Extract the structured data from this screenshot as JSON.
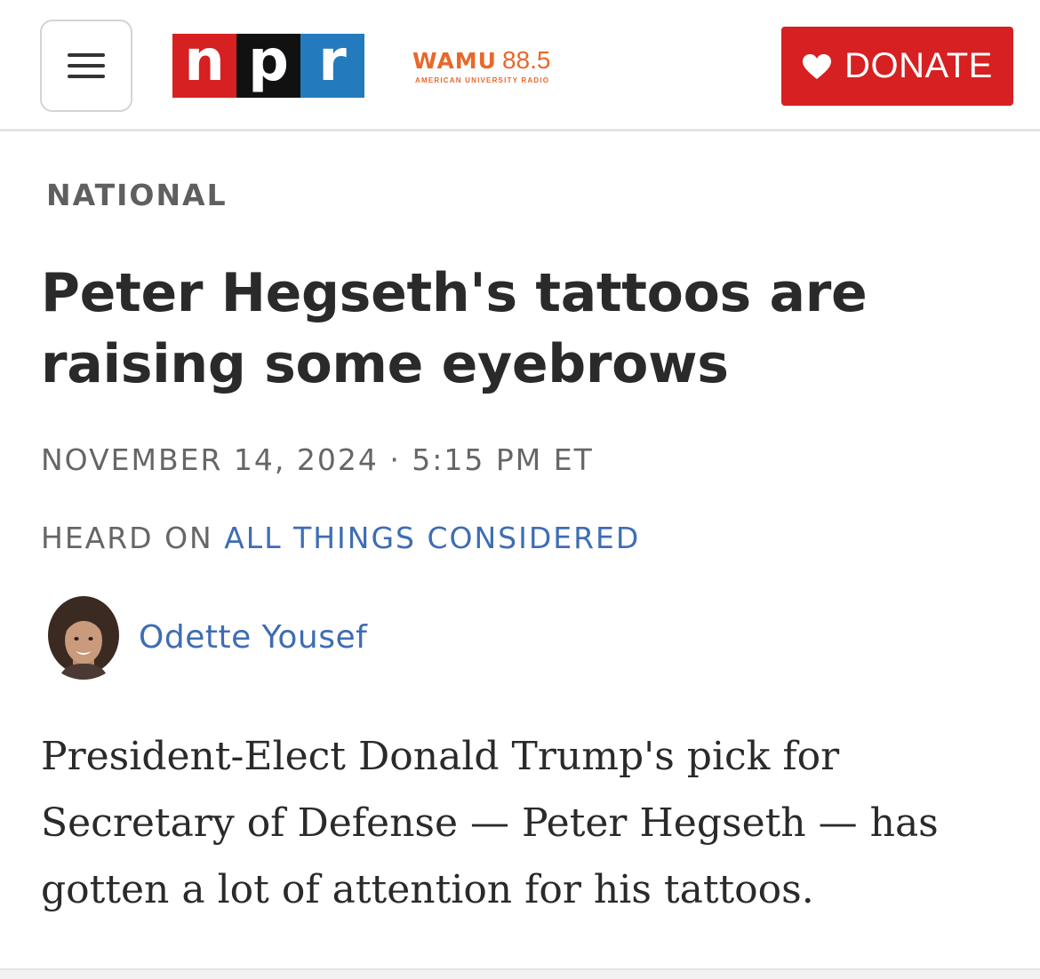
{
  "header": {
    "menu_icon": "hamburger-menu-icon",
    "logo": {
      "letters": [
        "n",
        "p",
        "r"
      ],
      "colors": [
        "#d62021",
        "#111111",
        "#237bbd"
      ]
    },
    "station": {
      "name": "WAMU",
      "frequency": "88.5",
      "subtitle": "AMERICAN UNIVERSITY RADIO",
      "color": "#e8682b"
    },
    "donate": {
      "label": "DONATE",
      "icon": "heart-icon",
      "color": "#d62021"
    }
  },
  "article": {
    "section": "NATIONAL",
    "headline": "Peter Hegseth's tattoos are raising some eyebrows",
    "dateline": "NOVEMBER 14, 2024 · 5:15 PM ET",
    "heard_on_prefix": "HEARD ON",
    "program": "ALL THINGS CONSIDERED",
    "author": "Odette Yousef",
    "body": "President-Elect Donald Trump's pick for Secretary of Defense — Peter Hegseth — has gotten a lot of attention for his tattoos."
  },
  "colors": {
    "link": "#3e6db4",
    "text": "#2a2a2a",
    "meta": "#666666"
  }
}
